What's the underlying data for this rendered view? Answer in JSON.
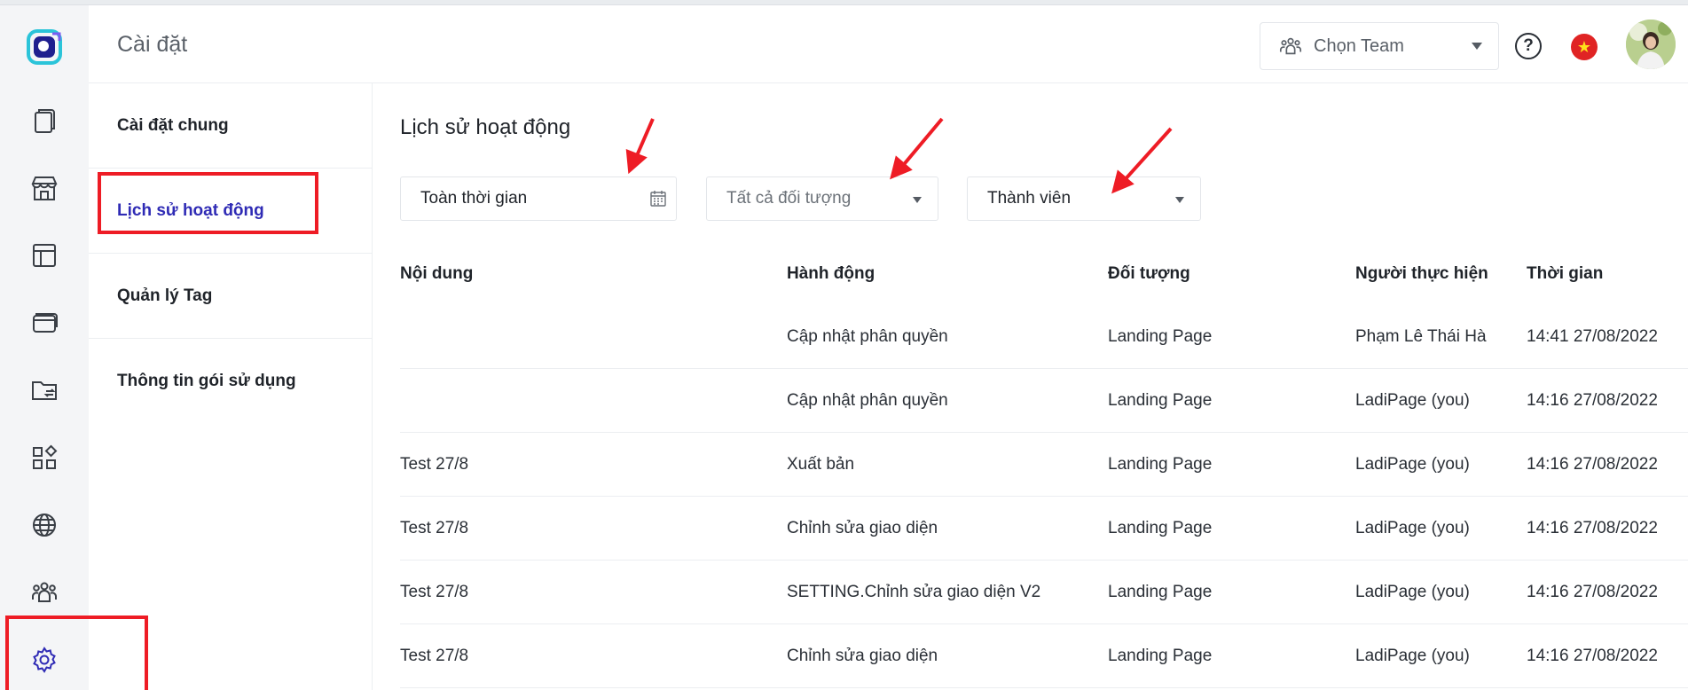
{
  "header": {
    "title": "Cài đặt",
    "team_select": {
      "label": "Chọn Team"
    },
    "help_label": "?"
  },
  "submenu": {
    "items": [
      {
        "label": "Cài đặt chung"
      },
      {
        "label": "Lịch sử hoạt động"
      },
      {
        "label": "Quản lý Tag"
      },
      {
        "label": "Thông tin gói sử dụng"
      }
    ]
  },
  "main": {
    "title": "Lịch sử hoạt động",
    "filters": {
      "time": "Toàn thời gian",
      "object": "Tất cả đối tượng",
      "member": "Thành viên"
    },
    "table": {
      "headers": [
        "Nội dung",
        "Hành động",
        "Đối tượng",
        "Người thực hiện",
        "Thời gian"
      ],
      "rows": [
        [
          "",
          "Cập nhật phân quyền",
          "Landing Page",
          "Phạm Lê Thái Hà",
          "14:41 27/08/2022"
        ],
        [
          "",
          "Cập nhật phân quyền",
          "Landing Page",
          "LadiPage (you)",
          "14:16 27/08/2022"
        ],
        [
          "Test 27/8",
          "Xuất bản",
          "Landing Page",
          "LadiPage (you)",
          "14:16 27/08/2022"
        ],
        [
          "Test 27/8",
          "Chỉnh sửa giao diện",
          "Landing Page",
          "LadiPage (you)",
          "14:16 27/08/2022"
        ],
        [
          "Test 27/8",
          "SETTING.Chỉnh sửa giao diện V2",
          "Landing Page",
          "LadiPage (you)",
          "14:16 27/08/2022"
        ],
        [
          "Test 27/8",
          "Chỉnh sửa giao diện",
          "Landing Page",
          "LadiPage (you)",
          "14:16 27/08/2022"
        ]
      ]
    }
  },
  "colors": {
    "accent": "#2f2bb5",
    "annotation": "#ee1c25"
  },
  "icons": {
    "rail": [
      "pages-icon",
      "store-icon",
      "layout-icon",
      "cards-icon",
      "folder-transfer-icon",
      "apps-icon",
      "globe-icon",
      "team-icon",
      "settings-icon"
    ]
  }
}
